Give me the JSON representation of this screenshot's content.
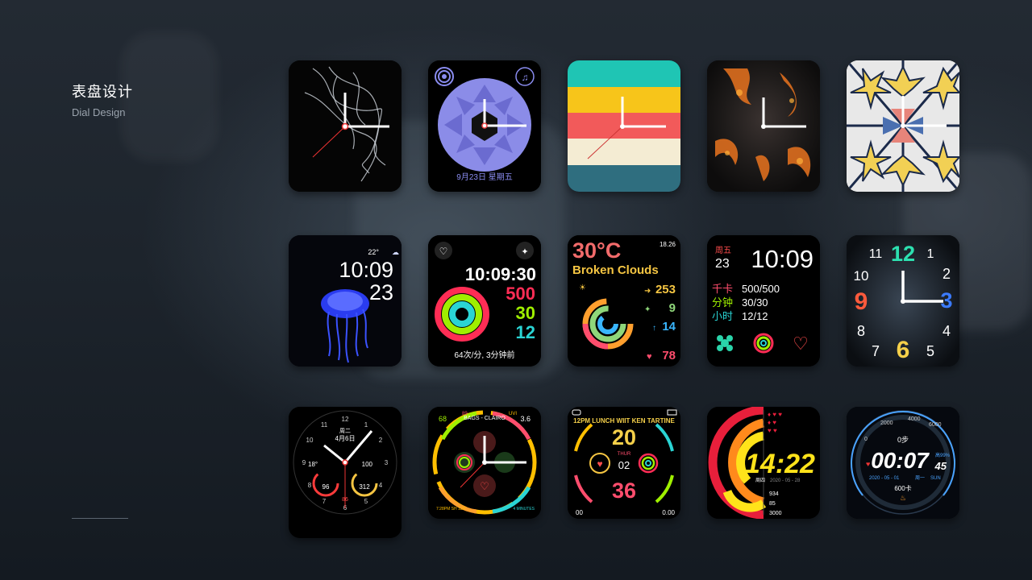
{
  "header": {
    "title": "表盘设计",
    "subtitle": "Dial Design"
  },
  "watches": {
    "w02": {
      "date": "9月23日 星期五"
    },
    "w06": {
      "temp": "22°",
      "time": "10:09",
      "day": "23"
    },
    "w07": {
      "time": "10:09:30",
      "move": "500",
      "exercise": "30",
      "stand": "12",
      "heart": "64次/分, 3分钟前"
    },
    "w08": {
      "temp": "30°C",
      "condition": "Broken Clouds",
      "clock": "18.26",
      "v1": "253",
      "v2": "9",
      "v3": "14",
      "v4": "78"
    },
    "w09": {
      "weekday": "周五",
      "day": "23",
      "time": "10:09",
      "l1": "千卡",
      "r1": "500/500",
      "l2": "分钟",
      "r2": "30/30",
      "l3": "小时",
      "r3": "12/12"
    },
    "w10": {
      "n12": "12",
      "n1": "1",
      "n2": "2",
      "n3": "3",
      "n4": "4",
      "n5": "5",
      "n6": "6",
      "n7": "7",
      "n8": "8",
      "n9": "9",
      "n10": "10",
      "n11": "11"
    },
    "w11": {
      "date_top": "周二",
      "date": "4月6日",
      "temp": "18°",
      "battery": "100",
      "heart": "96",
      "steps": "312",
      "sub": "86",
      "n12": "12",
      "n1": "1",
      "n2": "2",
      "n3": "3",
      "n4": "4",
      "n5": "5",
      "n6": "6",
      "n7": "7",
      "n8": "8",
      "n9": "9",
      "n10": "10",
      "n11": "11"
    },
    "w12": {
      "top": "BAGS - CLAIRO",
      "left": "68",
      "right": "3.6",
      "uv": "UVI",
      "a": "89",
      "bottom_left": "7:28PM SH 11M",
      "bottom_right": "4 MINUTES"
    },
    "w13": {
      "arc": "12PM LUNCH WIIT KEN TARTINE",
      "big1": "20",
      "day": "THUR",
      "date": "02",
      "big2": "36",
      "left": "00",
      "right": "0.00"
    },
    "w14": {
      "time": "14:22",
      "weekday": "周四",
      "date": "2020 - 05 - 28",
      "s1": "934",
      "s2": "85",
      "s3": "3000"
    },
    "w15": {
      "time": "00:07",
      "sec": "45",
      "pct": "高99%",
      "date": "2020 - 05 - 01",
      "weekday": "周一",
      "sun": "SUN",
      "steps": "0步",
      "kcal": "600卡",
      "s0": "0",
      "s2000": "2000",
      "s4000": "4000",
      "s6000": "6000"
    }
  },
  "colors": {
    "accent_red": "#ff3b5c",
    "accent_green": "#9fef00",
    "accent_cyan": "#2ad4d4"
  }
}
